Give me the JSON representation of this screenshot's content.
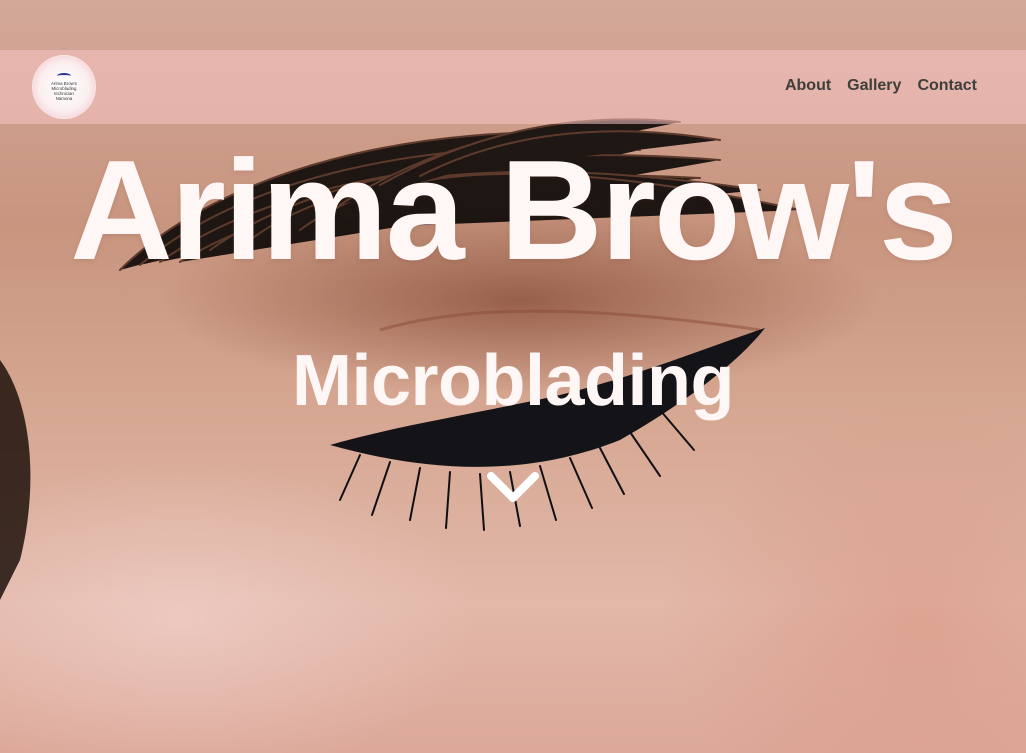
{
  "brand": {
    "logo_text": "Arima Brow's\nMicroblading\ntechnician\nNamona"
  },
  "nav": {
    "items": [
      {
        "label": "About"
      },
      {
        "label": "Gallery"
      },
      {
        "label": "Contact"
      }
    ]
  },
  "hero": {
    "title": "Arima Brow's",
    "subtitle": "Microblading",
    "scroll_icon": "chevron-down-icon"
  },
  "colors": {
    "nav_bar": "#f7c4c4",
    "nav_text": "#3e3e3a",
    "hero_text": "#fff6f6",
    "logo_accent": "#25318a"
  }
}
